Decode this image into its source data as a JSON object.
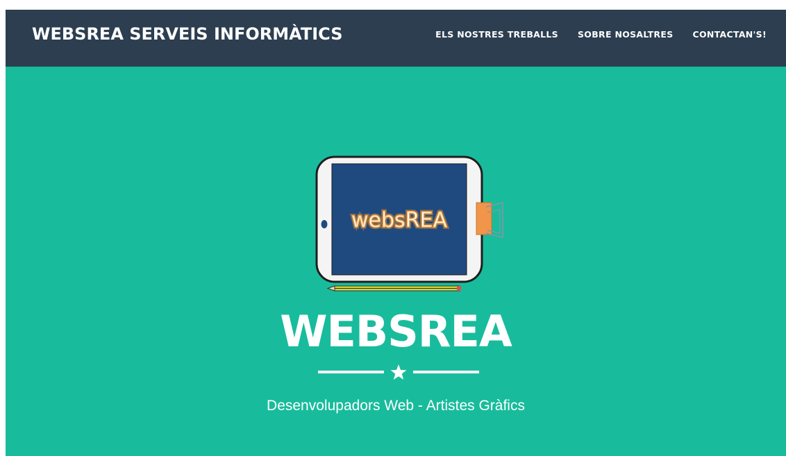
{
  "navbar": {
    "brand": "WEBSREA SERVEIS INFORMÀTICS",
    "links": [
      {
        "label": "ELS NOSTRES TREBALLS"
      },
      {
        "label": "SOBRE NOSALTRES"
      },
      {
        "label": "CONTACTAN'S!"
      }
    ],
    "background_color": "#2c3e50"
  },
  "hero": {
    "logo_text": "websREA",
    "title": "WEBSREA",
    "divider_icon": "star-icon",
    "subtitle": "Desenvolupadors Web - Artistes Gràfics",
    "background_color": "#18bc9c"
  }
}
